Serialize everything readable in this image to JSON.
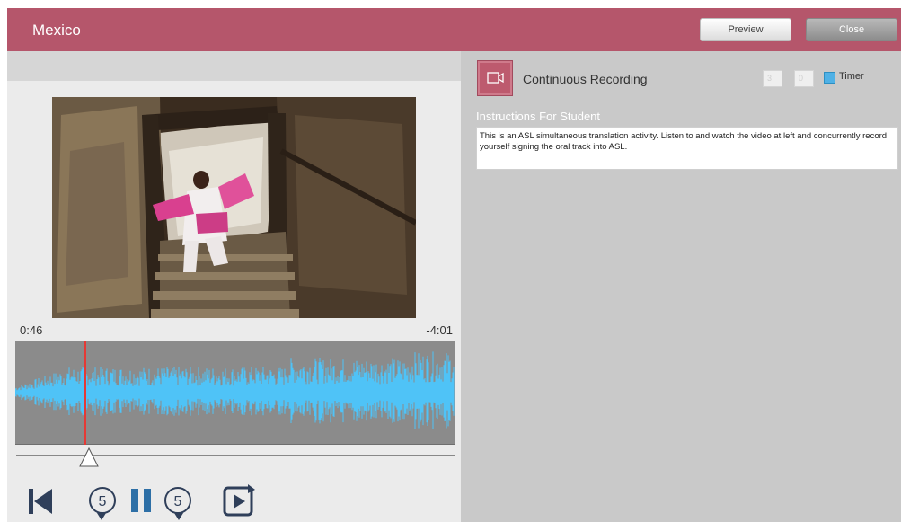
{
  "header": {
    "title": "Mexico",
    "preview_label": "Preview",
    "close_label": "Close",
    "bg_color": "#b5566b"
  },
  "player": {
    "elapsed": "0:46",
    "remaining": "-4:01",
    "playhead_fraction": 0.16,
    "waveform_color": "#4fc3f7",
    "playhead_color": "#e53935",
    "controls": {
      "skip_back_seconds": "5",
      "skip_forward_seconds": "5",
      "state": "playing"
    }
  },
  "recording": {
    "label": "Continuous Recording",
    "timer_minutes": "3",
    "timer_seconds": "0",
    "timer_label": "Timer",
    "timer_checked": true
  },
  "instructions": {
    "title": "Instructions For Student",
    "text": "This is an ASL simultaneous translation activity.  Listen to and watch the video at left and concurrently record yourself signing the oral track into ASL."
  }
}
